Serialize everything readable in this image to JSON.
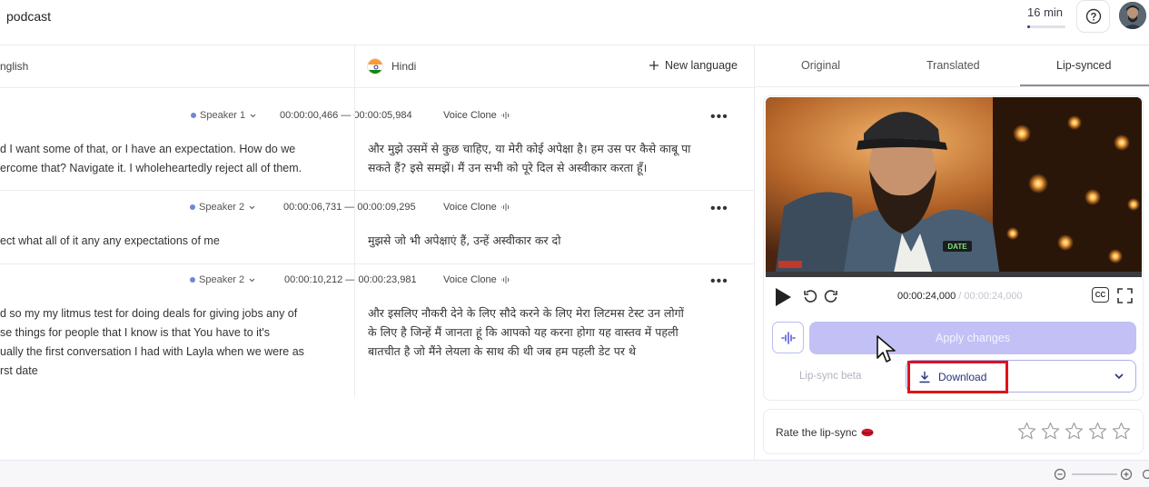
{
  "header": {
    "project_title": "podcast",
    "duration": "16 min",
    "duration_progress": 0.08,
    "help_icon": "help-circle-icon"
  },
  "languages": {
    "source": "nglish",
    "target": "Hindi",
    "new_language": "New language"
  },
  "segments": [
    {
      "speaker": "Speaker 1",
      "start": "00:00:00,466",
      "end": "00:00:05,984",
      "voice": "Voice Clone",
      "source_lines": [
        "d I want some of that, or I have an expectation. How do we",
        "ercome that? Navigate it. I wholeheartedly reject all of them."
      ],
      "target_lines": [
        "और मुझे उसमें से कुछ चाहिए, या मेरी कोई अपेक्षा है। हम उस पर कैसे काबू पा",
        "सकते हैं? इसे समझें। मैं उन सभी को पूरे दिल से अस्वीकार करता हूँ।"
      ]
    },
    {
      "speaker": "Speaker 2",
      "start": "00:00:06,731",
      "end": "00:00:09,295",
      "voice": "Voice Clone",
      "source_lines": [
        "ect what all of it any any expectations of me"
      ],
      "target_lines": [
        "मुझसे जो भी अपेक्षाएं हैं, उन्हें अस्वीकार कर दो"
      ]
    },
    {
      "speaker": "Speaker 2",
      "start": "00:00:10,212",
      "end": "00:00:23,981",
      "voice": "Voice Clone",
      "source_lines": [
        "d so my my litmus test for doing deals for giving jobs any of",
        "se things for people that I know is that You have to it's",
        "ually the first conversation I had with Layla when we were as",
        "rst date"
      ],
      "target_lines": [
        "और इसलिए नौकरी देने के लिए सौदे करने के लिए मेरा लिटमस टेस्ट उन लोगों",
        "के लिए है जिन्हें मैं जानता हूं कि आपको यह करना होगा यह वास्तव में पहली",
        "बातचीत है जो मैंने लेयला के साथ की थी जब हम पहली डेट पर थे"
      ]
    }
  ],
  "tabs": [
    "Original",
    "Translated",
    "Lip-synced"
  ],
  "active_tab": "Lip-synced",
  "video": {
    "badge": "DATE"
  },
  "player": {
    "current_time": "00:00:24,000",
    "separator": " / ",
    "total_time": "00:00:24,000",
    "cc_label": "CC"
  },
  "actions": {
    "apply_changes": "Apply changes",
    "lip_sync_beta": "Lip-sync beta",
    "download": "Download"
  },
  "rating": {
    "label": "Rate the lip-sync",
    "max_stars": 5,
    "value": 0
  },
  "colors": {
    "accent": "#c2c0f5",
    "highlight_box": "#e0121a",
    "speaker_dot": "#6e87d8"
  }
}
